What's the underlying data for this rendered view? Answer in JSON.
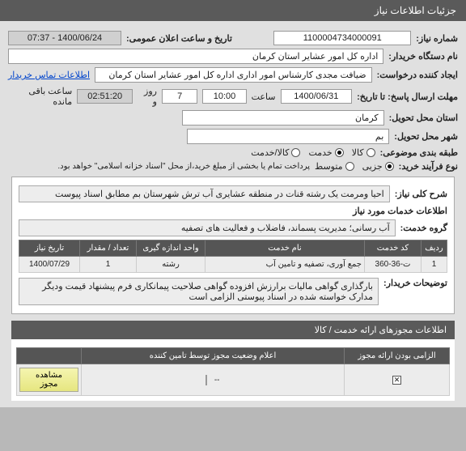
{
  "header": {
    "title": "جزئیات اطلاعات نیاز"
  },
  "top": {
    "need_no_label": "شماره نیاز:",
    "need_no": "1100004734000091",
    "announce_date_label": "تاریخ و ساعت اعلان عمومی:",
    "announce_date": "1400/06/24 - 07:37",
    "buyer_org_label": "نام دستگاه خریدار:",
    "buyer_org": "اداره کل امور عشایر استان کرمان",
    "creator_label": "ایجاد کننده درخواست:",
    "creator": "ضیافت مجدی کارشناس امور اداری اداره کل امور عشایر استان کرمان",
    "contact_link": "اطلاعات تماس خریدار",
    "deadline_label": "مهلت ارسال پاسخ: تا تاریخ:",
    "deadline_date": "1400/06/31",
    "time_label": "ساعت",
    "deadline_time": "10:00",
    "day_label": "روز و",
    "days_left": "7",
    "remain_time": "02:51:20",
    "remain_label": "ساعت باقی مانده",
    "province_label": "استان محل تحویل:",
    "province": "کرمان",
    "city_label": "شهر محل تحویل:",
    "city": "بم",
    "category_label": "طبقه بندی موضوعی:",
    "cat_kala": "کالا",
    "cat_khadamat": "خدمت",
    "cat_both": "کالا/خدمت",
    "process_label": "نوع فرآیند خرید:",
    "proc_jozei": "جزیی",
    "proc_motevasset": "متوسط",
    "proc_note": "پرداخت تمام یا بخشی از مبلغ خرید،از محل \"اسناد خزانه اسلامی\" خواهد بود."
  },
  "inner": {
    "need_title_label": "شرح کلی نیاز:",
    "need_title": "احیا ومرمت یک رشته قنات در منطقه عشایری آب ترش شهرستان بم مطابق اسناد پیوست",
    "services_header": "اطلاعات خدمات مورد نیاز",
    "service_group_label": "گروه خدمت:",
    "service_group": "آب رسانی؛ مدیریت پسماند، فاضلاب و فعالیت های تصفیه",
    "table": {
      "headers": [
        "ردیف",
        "کد خدمت",
        "نام خدمت",
        "واحد اندازه گیری",
        "تعداد / مقدار",
        "تاریخ نیاز"
      ],
      "row": {
        "rownum": "1",
        "code": "ت-36-360",
        "name": "جمع آوری، تصفیه و تامین آب",
        "unit": "رشته",
        "qty": "1",
        "date": "1400/07/29"
      }
    },
    "buyer_notes_label": "توضیحات خریدار:",
    "buyer_notes": "بارگذاری گواهی مالیات برارزش افزوده گواهی صلاحیت پیمانکاری فرم پیشنهاد قیمت ودیگر مدارک خواسته شده در اسناد پیوستی الزامی است"
  },
  "footer": {
    "section_title": "اطلاعات مجوزهای ارائه خدمت / کالا",
    "col_mandatory": "الزامی بودن ارائه مجوز",
    "col_status": "اعلام وضعیت مجوز توسط تامین کننده",
    "btn_view": "مشاهده مجوز",
    "dash": "--"
  }
}
